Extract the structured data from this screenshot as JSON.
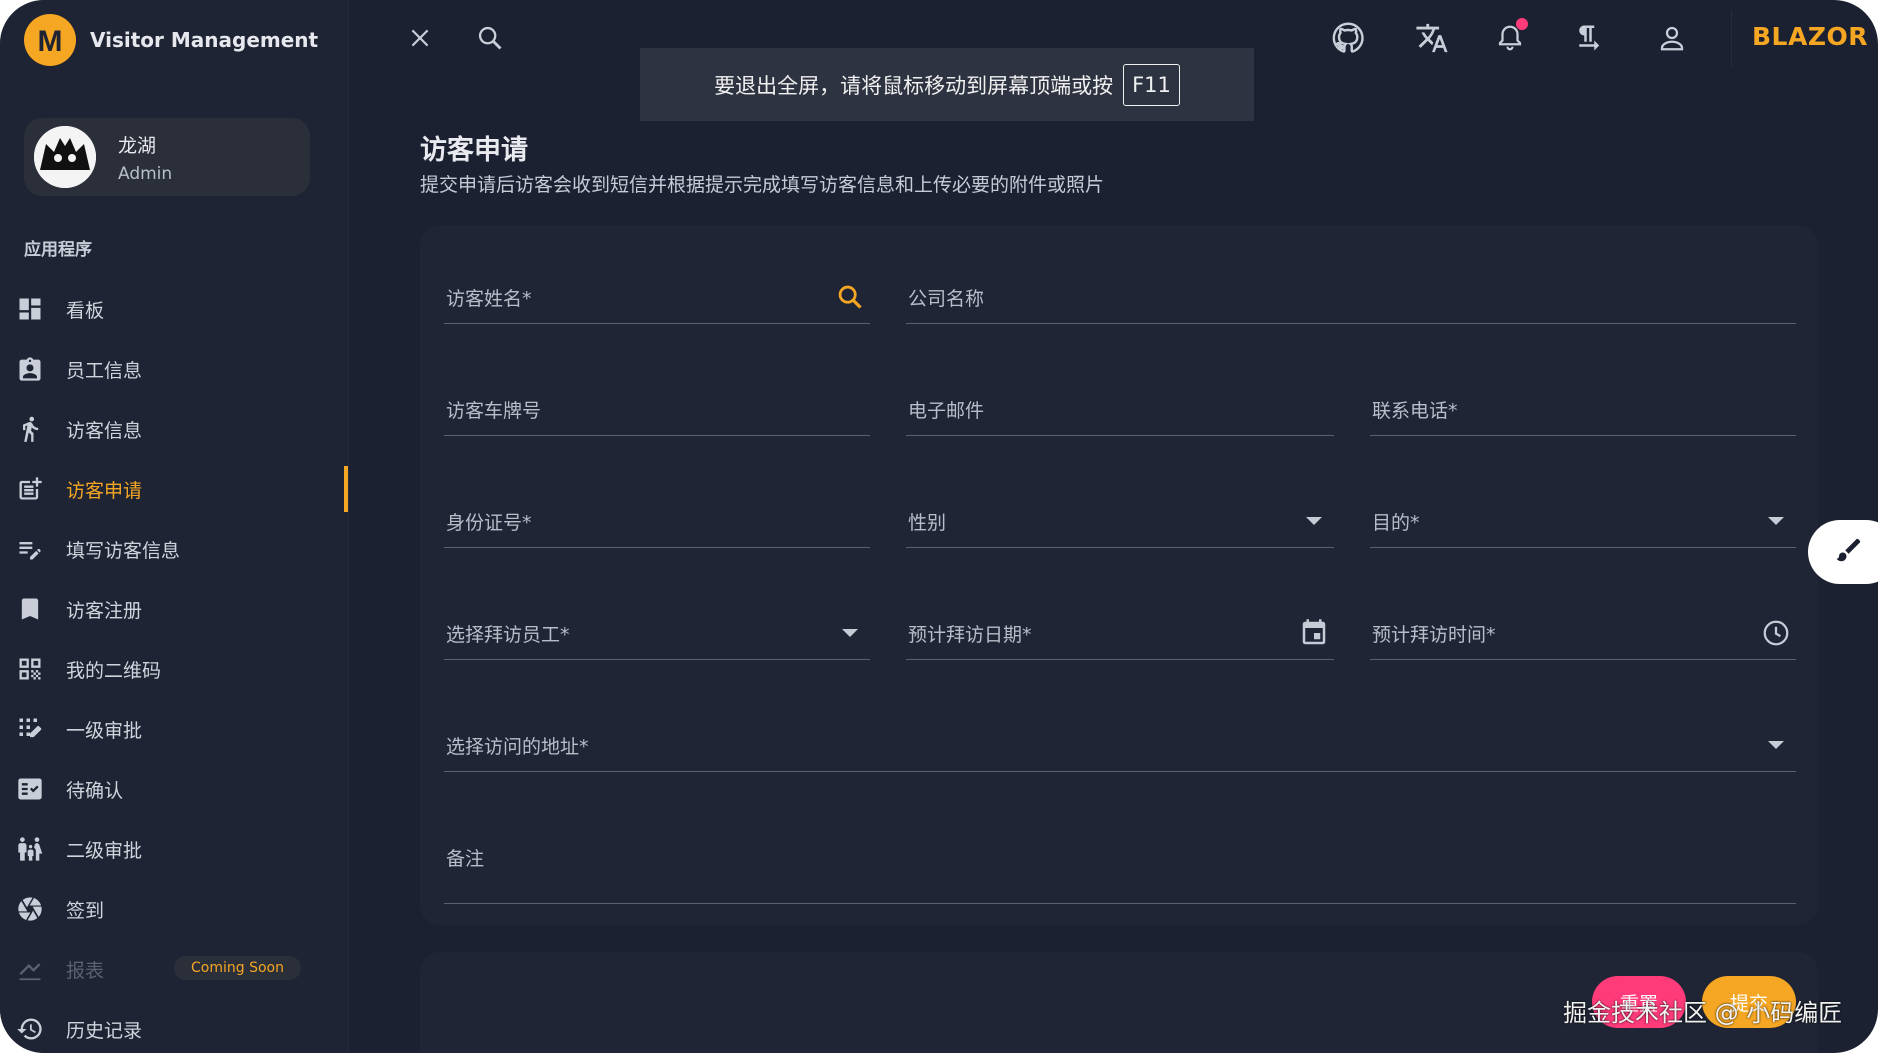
{
  "app": {
    "title": "Visitor Management",
    "brand_right": "BLAZOR"
  },
  "user": {
    "name": "龙湖",
    "role": "Admin"
  },
  "sidebar": {
    "section_label": "应用程序",
    "items": [
      {
        "label": "看板",
        "icon": "dashboard-icon"
      },
      {
        "label": "员工信息",
        "icon": "badge-icon"
      },
      {
        "label": "访客信息",
        "icon": "walking-person-icon"
      },
      {
        "label": "访客申请",
        "icon": "post-add-icon",
        "active": true
      },
      {
        "label": "填写访客信息",
        "icon": "edit-list-icon"
      },
      {
        "label": "访客注册",
        "icon": "bookmark-icon"
      },
      {
        "label": "我的二维码",
        "icon": "qr-code-icon"
      },
      {
        "label": "一级审批",
        "icon": "edit-grid-icon"
      },
      {
        "label": "待确认",
        "icon": "checklist-icon"
      },
      {
        "label": "二级审批",
        "icon": "family-icon"
      },
      {
        "label": "签到",
        "icon": "shutter-icon"
      },
      {
        "label": "报表",
        "icon": "chart-icon",
        "disabled": true,
        "badge": "Coming Soon"
      },
      {
        "label": "历史记录",
        "icon": "history-icon"
      }
    ]
  },
  "fullscreen_toast": {
    "text": "要退出全屏，请将鼠标移动到屏幕顶端或按",
    "key": "F11"
  },
  "page": {
    "title": "访客申请",
    "subtitle": "提交申请后访客会收到短信并根据提示完成填写访客信息和上传必要的附件或照片"
  },
  "form": {
    "visitor_name": "访客姓名*",
    "company_name": "公司名称",
    "license_plate": "访客车牌号",
    "email": "电子邮件",
    "phone": "联系电话*",
    "id_number": "身份证号*",
    "gender": "性别",
    "purpose": "目的*",
    "employee": "选择拜访员工*",
    "visit_date": "预计拜访日期*",
    "visit_time": "预计拜访时间*",
    "address": "选择访问的地址*",
    "remarks": "备注"
  },
  "actions": {
    "reset": "重置",
    "submit": "提交"
  },
  "watermark": "掘金技术社区 @ 小码编匠",
  "colors": {
    "accent": "#f5a623",
    "background": "#1b2130",
    "sidebar": "#1e2433",
    "danger": "#ff3b7a"
  }
}
